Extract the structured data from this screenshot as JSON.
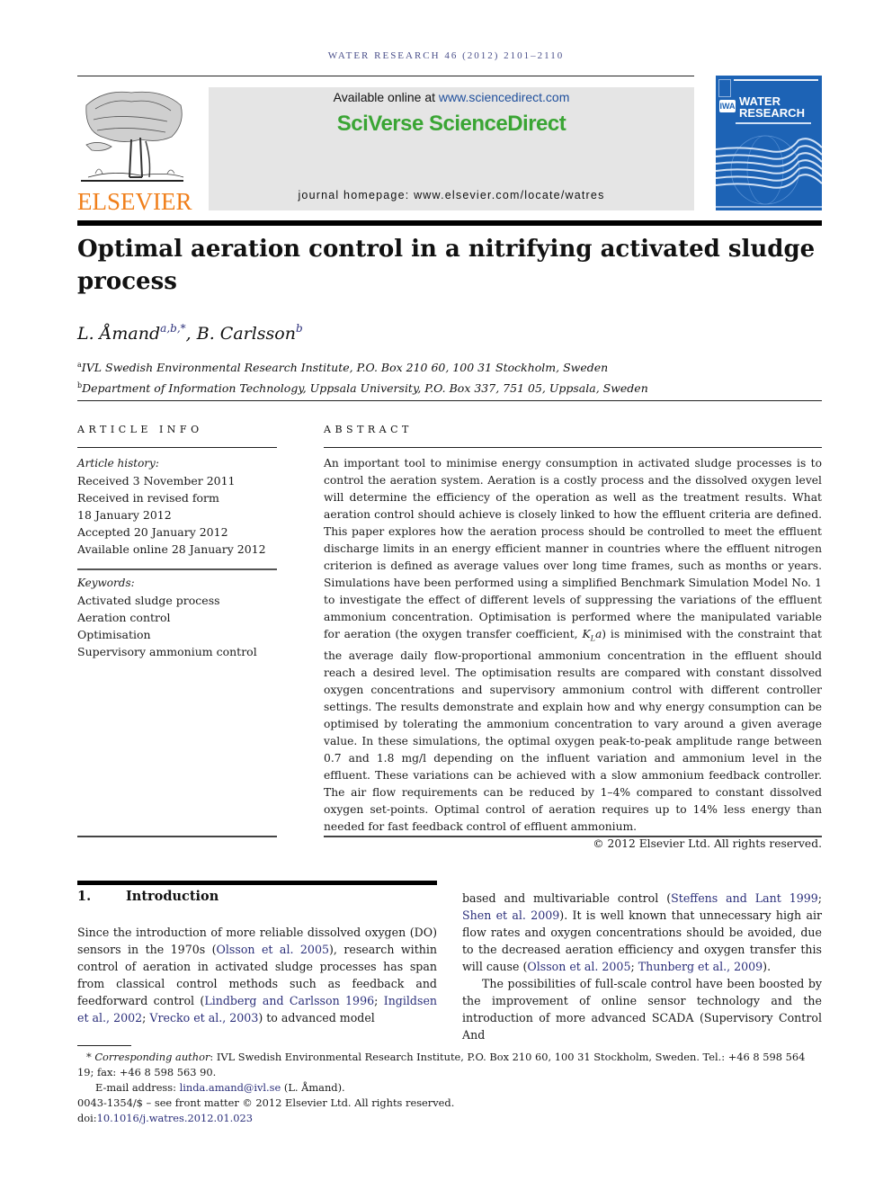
{
  "journal": {
    "running_head": "WATER RESEARCH 46 (2012) 2101–2110",
    "publisher_logo_text": "ELSEVIER",
    "available_prefix": "Available online at ",
    "available_link": "www.sciencedirect.com",
    "platform_brand": "SciVerse ScienceDirect",
    "homepage": "journal homepage: www.elsevier.com/locate/watres",
    "cover_badge": "IWA",
    "cover_title_line1": "WATER",
    "cover_title_line2": "RESEARCH",
    "colors": {
      "elsevier_orange": "#f07f1b",
      "sciencedirect_green": "#3aa534",
      "cover_blue": "#1d63b5",
      "link_blue": "#2b2f7a"
    }
  },
  "article": {
    "title": "Optimal aeration control in a nitrifying activated sludge process",
    "authors": [
      {
        "name": "L. Åmand",
        "marks": "a,b,*"
      },
      {
        "name": "B. Carlsson",
        "marks": "b"
      }
    ],
    "author_separator": ", ",
    "affiliations": [
      {
        "mark": "a",
        "text": "IVL Swedish Environmental Research Institute, P.O. Box 210 60, 100 31 Stockholm, Sweden"
      },
      {
        "mark": "b",
        "text": "Department of Information Technology, Uppsala University, P.O. Box 337, 751 05, Uppsala, Sweden"
      }
    ]
  },
  "article_info": {
    "heading": "ARTICLE INFO",
    "history_label": "Article history:",
    "history": [
      "Received 3 November 2011",
      "Received in revised form",
      "18 January 2012",
      "Accepted 20 January 2012",
      "Available online 28 January 2012"
    ],
    "keywords_label": "Keywords:",
    "keywords": [
      "Activated sludge process",
      "Aeration control",
      "Optimisation",
      "Supervisory ammonium control"
    ]
  },
  "abstract": {
    "heading": "ABSTRACT",
    "text_before_kla": "An important tool to minimise energy consumption in activated sludge processes is to control the aeration system. Aeration is a costly process and the dissolved oxygen level will determine the efficiency of the operation as well as the treatment results. What aeration control should achieve is closely linked to how the effluent criteria are defined. This paper explores how the aeration process should be controlled to meet the effluent discharge limits in an energy efficient manner in countries where the effluent nitrogen criterion is defined as average values over long time frames, such as months or years. Simulations have been performed using a simplified Benchmark Simulation Model No. 1 to investigate the effect of different levels of suppressing the variations of the effluent ammonium concentration. Optimisation is performed where the manipulated variable for aeration (the oxygen transfer coefficient, ",
    "kla_symbol": "K",
    "kla_sub": "L",
    "kla_tail": "a",
    "text_after_kla": ") is minimised with the constraint that the average daily flow-proportional ammonium concentration in the effluent should reach a desired level. The optimisation results are compared with constant dissolved oxygen concentrations and supervisory ammonium control with different controller settings. The results demonstrate and explain how and why energy consumption can be optimised by tolerating the ammonium concentration to vary around a given average value. In these simulations, the optimal oxygen peak-to-peak amplitude range between 0.7 and 1.8 mg/l depending on the influent variation and ammonium level in the effluent. These variations can be achieved with a slow ammonium feedback controller. The air flow requirements can be reduced by 1–4% compared to constant dissolved oxygen set-points. Optimal control of aeration requires up to 14% less energy than needed for fast feedback control of effluent ammonium.",
    "copyright": "© 2012 Elsevier Ltd. All rights reserved."
  },
  "introduction": {
    "number": "1.",
    "heading": "Introduction",
    "left": {
      "t1": "Since the introduction of more reliable dissolved oxygen (DO) sensors in the 1970s (",
      "r1": "Olsson et al. 2005",
      "t2": "), research within control of aeration in activated sludge processes has span from classical control methods such as feedback and feedforward control (",
      "r2": "Lindberg and Carlsson 1996",
      "t3": "; ",
      "r3": "Ingildsen et al., 2002",
      "t4": "; ",
      "r4": "Vrecko et al., 2003",
      "t5": ") to advanced model"
    },
    "right": {
      "t1": "based and multivariable control (",
      "r1": "Steffens and Lant 1999",
      "t2": "; ",
      "r2": "Shen et al. 2009",
      "t3": "). It is well known that unnecessary high air flow rates and oxygen concentrations should be avoided, due to the decreased aeration efficiency and oxygen transfer this will cause (",
      "r3": "Olsson et al. 2005",
      "t4": "; ",
      "r4": "Thunberg et al., 2009",
      "t5": ").",
      "p2": "The possibilities of full-scale control have been boosted by the improvement of online sensor technology and the introduction of more advanced SCADA (Supervisory Control And"
    }
  },
  "footnotes": {
    "star": "*",
    "corr_label": "Corresponding author",
    "corr_text": ": IVL Swedish Environmental Research Institute, P.O. Box 210 60, 100 31 Stockholm, Sweden. Tel.: +46 8 598 564 19; fax: +46 8 598 563 90.",
    "email_label": "E-mail address: ",
    "email": "linda.amand@ivl.se",
    "email_suffix": " (L. Åmand).",
    "issn_line": "0043-1354/$ – see front matter © 2012 Elsevier Ltd. All rights reserved.",
    "doi_prefix": "doi:",
    "doi": "10.1016/j.watres.2012.01.023"
  }
}
